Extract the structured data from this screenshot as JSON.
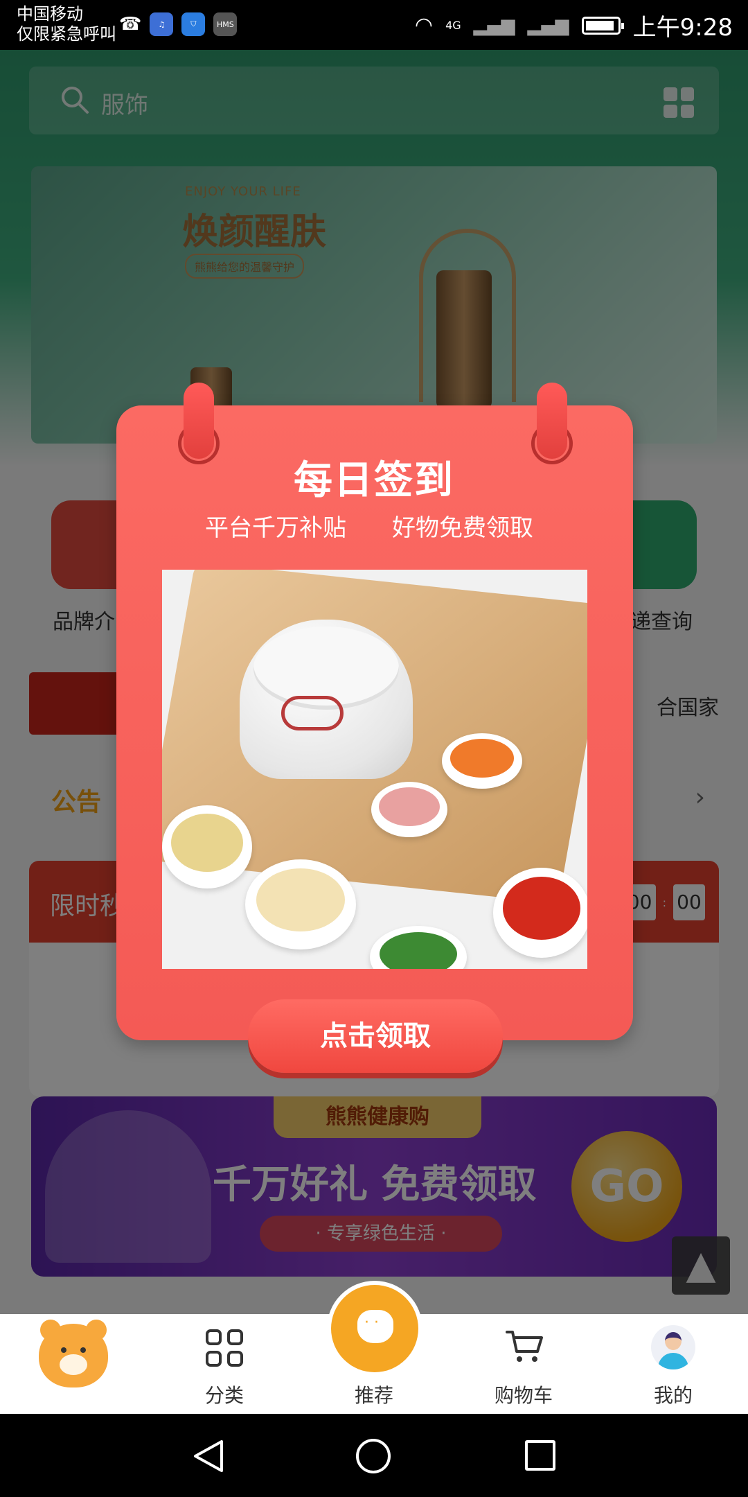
{
  "status_bar": {
    "carrier_line1": "中国移动",
    "carrier_line2": "仅限紧急呼叫",
    "network": "4G",
    "time": "上午9:28"
  },
  "search": {
    "placeholder": "服饰"
  },
  "banner": {
    "en": "ENJOY YOUR LIFE",
    "cn": "焕颜醒肤",
    "pill": "熊熊给您的温馨守护"
  },
  "quick_links": [
    {
      "label": "品牌介"
    },
    {
      "label": "递查询"
    }
  ],
  "brand_row": {
    "text": "合国家"
  },
  "notice": {
    "title": "公告"
  },
  "flash_sale": {
    "title": "限时秒",
    "timer": [
      "00",
      "00"
    ]
  },
  "promo": {
    "tag": "熊熊健康购",
    "main": "千万好礼 免费领取",
    "sub": "· 专享绿色生活 ·",
    "go": "GO"
  },
  "modal": {
    "title": "每日签到",
    "subtitle_left": "平台千万补贴",
    "subtitle_right": "好物免费领取",
    "button": "点击领取"
  },
  "tabbar": {
    "tabs": [
      {
        "label": ""
      },
      {
        "label": "分类"
      },
      {
        "label": "推荐"
      },
      {
        "label": "购物车"
      },
      {
        "label": "我的"
      }
    ]
  },
  "colors": {
    "modal_red": "#f45a55",
    "tab_accent": "#f5a623",
    "notice_accent": "#f0a015"
  }
}
